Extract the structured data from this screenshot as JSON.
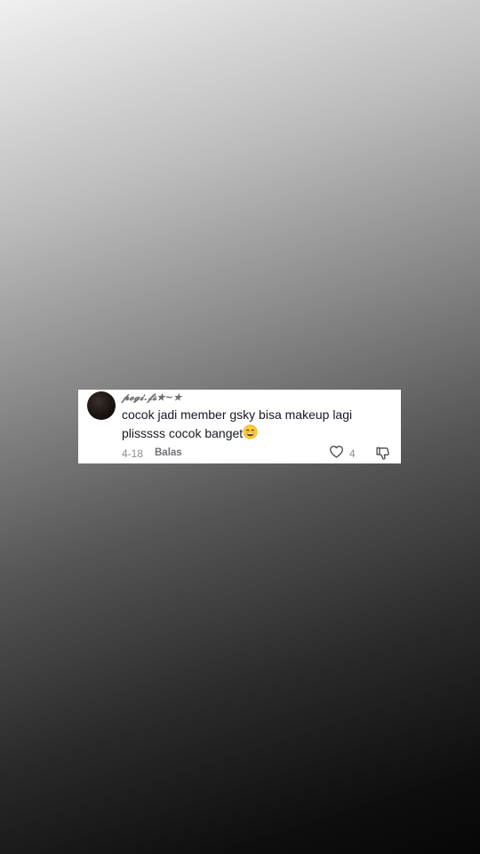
{
  "comment": {
    "username": "𝓹𝓮𝓰𝓲.𝓯𝓼★~★",
    "text_line1": "cocok jadi member gsky bisa makeup lagi",
    "text_line2": "plisssss cocok banget",
    "emoji": "grinning-face-with-smiling-eyes-emoji",
    "date": "4-18",
    "reply_label": "Balas",
    "like_count": "4"
  },
  "icons": {
    "like": "heart-icon",
    "dislike": "thumbs-down-icon"
  },
  "colors": {
    "card_background": "#ffffff",
    "text_primary": "#161823",
    "text_secondary": "#8a8b91"
  }
}
